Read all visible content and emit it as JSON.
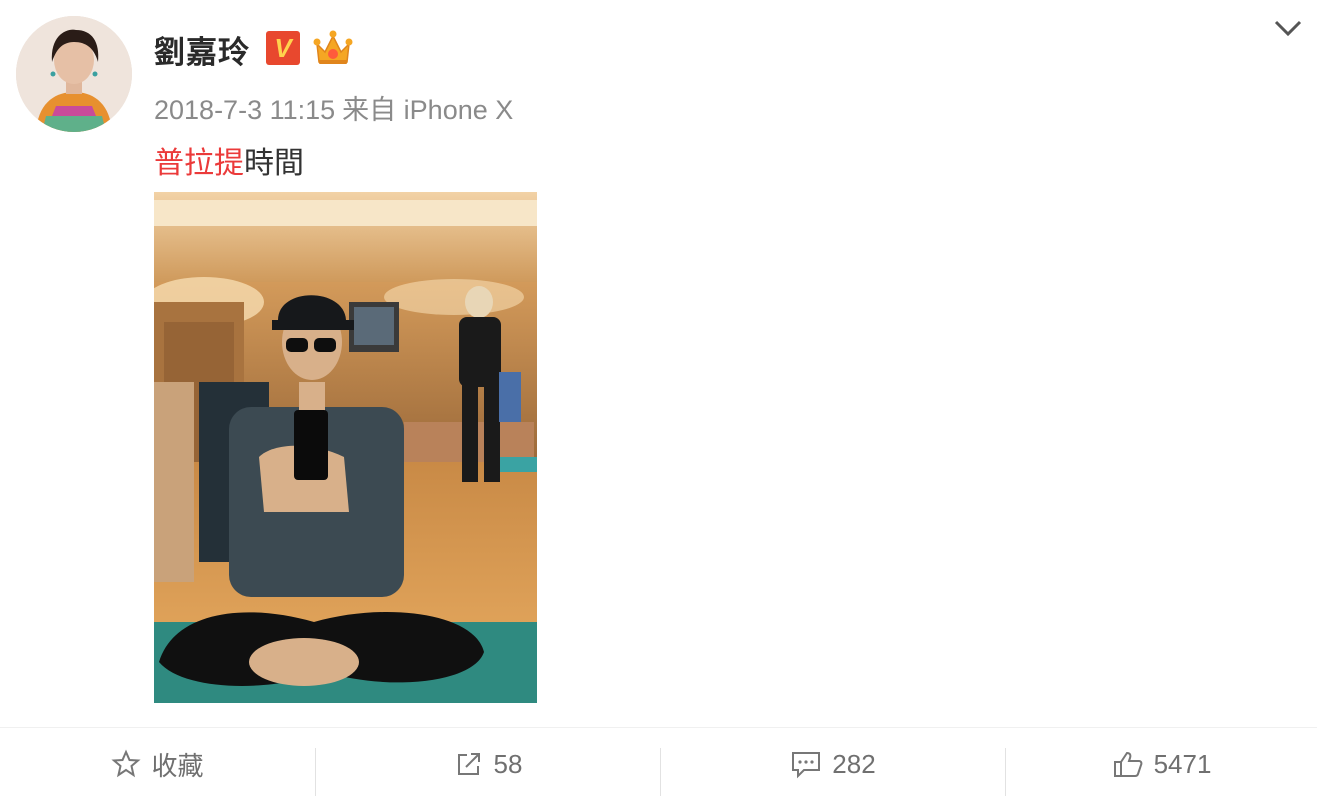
{
  "post": {
    "author": "劉嘉玲",
    "verified_mark": "V",
    "timestamp": "2018-7-3 11:15",
    "source_prefix": "来自",
    "source_device": "iPhone X",
    "topic": "普拉提",
    "text": "時間",
    "image_alt": "selfie in pilates studio mirror"
  },
  "actions": {
    "favorite_label": "收藏",
    "repost_count": "58",
    "comment_count": "282",
    "like_count": "5471"
  },
  "colors": {
    "topic": "#eb3a3a",
    "meta": "#8a8a8a",
    "verified_bg": "#e8482e",
    "verified_fg": "#ffd34d",
    "action_text": "#707070"
  },
  "icons": [
    "expand-chevron-icon",
    "verified-icon",
    "crown-icon",
    "star-icon",
    "share-icon",
    "comment-icon",
    "thumbs-up-icon"
  ]
}
